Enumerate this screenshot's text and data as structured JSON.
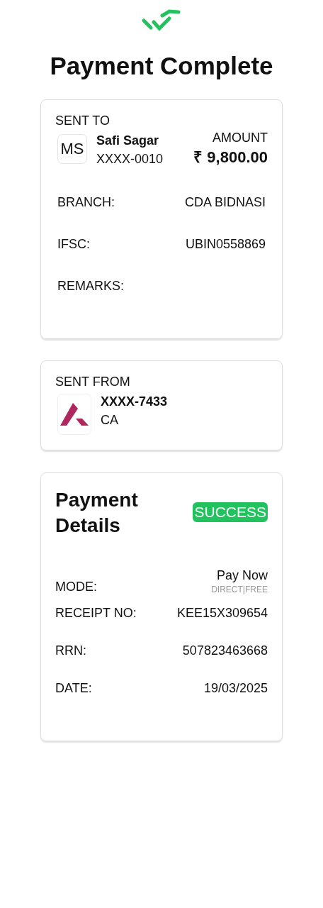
{
  "title": "Payment Complete",
  "sent_to": {
    "heading": "SENT TO",
    "initials": "MS",
    "name": "Safi Sagar",
    "account": "XXXX-0010",
    "amount_label": "AMOUNT",
    "amount": "₹ 9,800.00",
    "rows": [
      {
        "label": "BRANCH:",
        "value": "CDA BIDNASI"
      },
      {
        "label": "IFSC:",
        "value": "UBIN0558869"
      },
      {
        "label": "REMARKS:"
      }
    ]
  },
  "sent_from": {
    "heading": "SENT FROM",
    "account": "XXXX-7433",
    "type": "CA"
  },
  "payment_details": {
    "title": "Payment Details",
    "status": {
      "text": "SUCCESS",
      "kind": "success"
    },
    "rows": [
      {
        "label": "MODE:",
        "value": "Pay Now",
        "sub": "DIRECT|FREE"
      },
      {
        "label": "RECEIPT NO:",
        "value": "KEE15X309654"
      },
      {
        "label": "RRN:",
        "value": "507823463668"
      },
      {
        "label": "DATE:",
        "value": "19/03/2025"
      }
    ]
  }
}
